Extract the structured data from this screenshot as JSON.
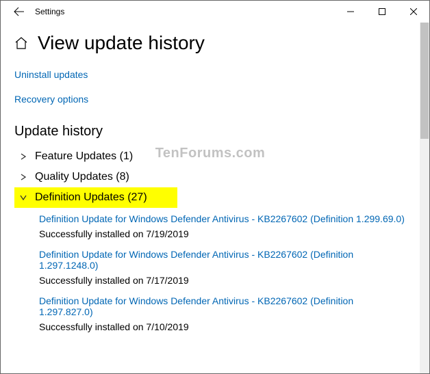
{
  "titlebar": {
    "title": "Settings"
  },
  "page": {
    "title": "View update history"
  },
  "links": {
    "uninstall": "Uninstall updates",
    "recovery": "Recovery options"
  },
  "section": {
    "heading": "Update history"
  },
  "categories": [
    {
      "label": "Feature Updates (1)",
      "expanded": false,
      "highlighted": false
    },
    {
      "label": "Quality Updates (8)",
      "expanded": false,
      "highlighted": false
    },
    {
      "label": "Definition Updates (27)",
      "expanded": true,
      "highlighted": true
    }
  ],
  "updates": [
    {
      "title": "Definition Update for Windows Defender Antivirus - KB2267602 (Definition 1.299.69.0)",
      "status": "Successfully installed on 7/19/2019"
    },
    {
      "title": "Definition Update for Windows Defender Antivirus - KB2267602 (Definition 1.297.1248.0)",
      "status": "Successfully installed on 7/17/2019"
    },
    {
      "title": "Definition Update for Windows Defender Antivirus - KB2267602 (Definition 1.297.827.0)",
      "status": "Successfully installed on 7/10/2019"
    }
  ],
  "watermark": "TenForums.com"
}
